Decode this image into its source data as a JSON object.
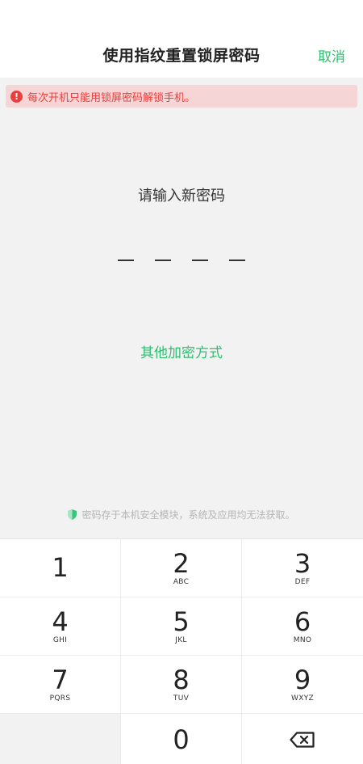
{
  "header": {
    "title": "使用指纹重置锁屏密码",
    "cancel_label": "取消"
  },
  "warning": {
    "icon": "exclamation-icon",
    "text": "每次开机只能用锁屏密码解锁手机。"
  },
  "prompt": "请输入新密码",
  "pin": {
    "length": 4,
    "entered": 0
  },
  "other_method_label": "其他加密方式",
  "security_note": {
    "icon": "shield-icon",
    "text": "密码存于本机安全模块，系统及应用均无法获取。"
  },
  "keypad": {
    "keys": [
      {
        "digit": "1",
        "letters": ""
      },
      {
        "digit": "2",
        "letters": "ABC"
      },
      {
        "digit": "3",
        "letters": "DEF"
      },
      {
        "digit": "4",
        "letters": "GHI"
      },
      {
        "digit": "5",
        "letters": "JKL"
      },
      {
        "digit": "6",
        "letters": "MNO"
      },
      {
        "digit": "7",
        "letters": "PQRS"
      },
      {
        "digit": "8",
        "letters": "TUV"
      },
      {
        "digit": "9",
        "letters": "WXYZ"
      },
      {
        "digit": "0",
        "letters": ""
      }
    ],
    "backspace_icon": "backspace-icon"
  },
  "colors": {
    "accent": "#2fbf71",
    "warning": "#e8403d",
    "warning_bg": "#f5d5d5",
    "content_bg": "#f2f2f2"
  }
}
